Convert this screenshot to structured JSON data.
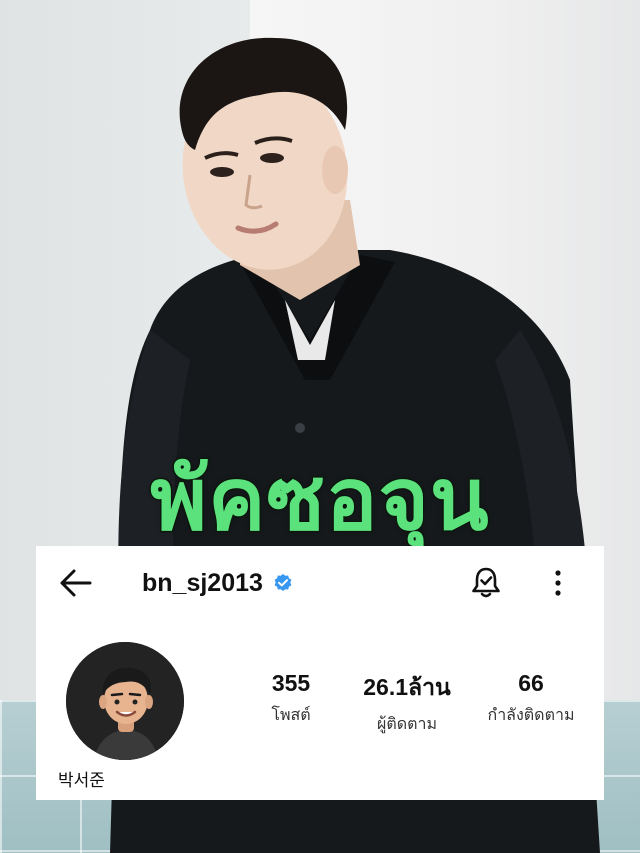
{
  "overlay": {
    "title": "พัคซอจุน"
  },
  "profile": {
    "username": "bn_sj2013",
    "display_name": "박서준",
    "verified": true,
    "avatar": "memoji-avatar",
    "stats": [
      {
        "value": "355",
        "label": "โพสต์"
      },
      {
        "value": "26.1ล้าน",
        "label": "ผู้ติดตาม"
      },
      {
        "value": "66",
        "label": "กำลังติดตาม"
      }
    ]
  },
  "icons": {
    "back": "back-arrow-icon",
    "verified": "verified-badge-icon",
    "notifications": "bell-icon",
    "more": "more-vertical-icon"
  },
  "colors": {
    "title_fill": "#5ce27c",
    "title_stroke": "#0d1a10",
    "verified_blue": "#3897f0",
    "card_bg": "#ffffff"
  }
}
